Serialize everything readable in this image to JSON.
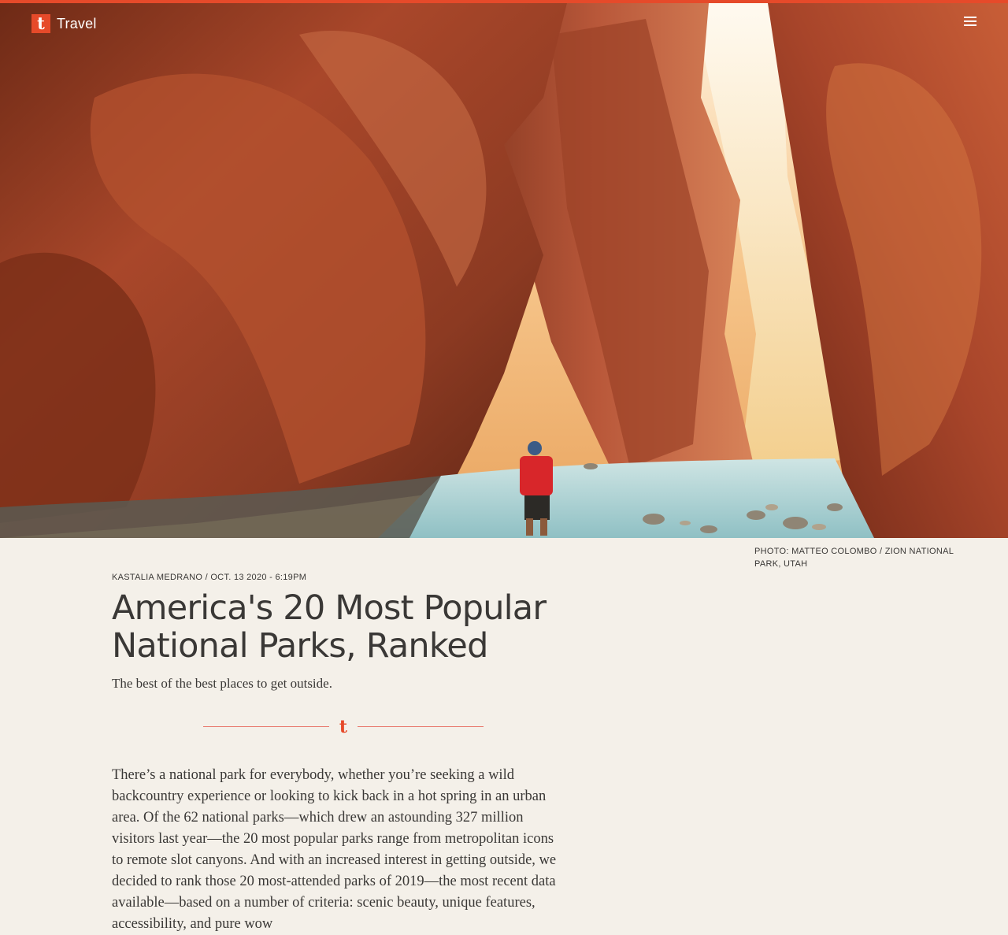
{
  "header": {
    "brand_logo_letter": "t",
    "brand_name": "Travel",
    "menu_icon": "hamburger-menu-icon",
    "accent_color": "#e64a2a"
  },
  "hero": {
    "photo_credit": "PHOTO: MATTEO COLOMBO / ZION NATIONAL PARK, UTAH"
  },
  "article": {
    "author": "KASTALIA MEDRANO",
    "separator": " / ",
    "date": "OCT. 13 2020 - 6:19PM",
    "headline": "America's 20 Most Popular National Parks, Ranked",
    "dek": "The best of the best places to get outside.",
    "divider_mark": "t",
    "body": "There’s a national park for everybody, whether you’re seeking a wild backcountry experience or looking to kick back in a hot spring in an urban area. Of the 62 national parks—which drew an astounding 327 million visitors last year—the 20 most popular parks range from metropolitan icons to remote slot canyons. And with an increased interest in getting outside, we decided to rank those 20 most-attended parks of 2019—the most recent data available—based on a number of criteria: scenic beauty, unique features, accessibility, and pure wow"
  }
}
